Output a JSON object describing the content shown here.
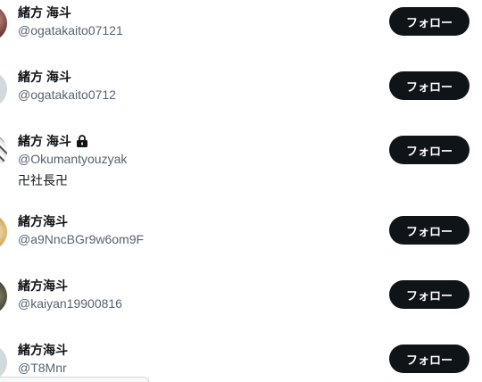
{
  "users": [
    {
      "name": "緒方 海斗",
      "handle": "@ogatakaito07121",
      "bio": "",
      "locked": false,
      "button": "フォロー",
      "avatar_icon": "user-avatar-photo"
    },
    {
      "name": "緒方 海斗",
      "handle": "@ogatakaito0712",
      "bio": "",
      "locked": false,
      "button": "フォロー",
      "avatar_icon": "default-avatar"
    },
    {
      "name": "緒方 海斗",
      "handle": "@Okumantyouzyak",
      "bio": "卍社長卍",
      "locked": true,
      "button": "フォロー",
      "avatar_icon": "user-avatar-photo"
    },
    {
      "name": "緒方海斗",
      "handle": "@a9NncBGr9w6om9F",
      "bio": "",
      "locked": false,
      "button": "フォロー",
      "avatar_icon": "user-avatar-photo"
    },
    {
      "name": "緒方海斗",
      "handle": "@kaiyan19900816",
      "bio": "",
      "locked": false,
      "button": "フォロー",
      "avatar_icon": "user-avatar-photo"
    },
    {
      "name": "緒方海斗",
      "handle": "@T8Mnr",
      "bio": "",
      "locked": false,
      "button": "フォロー",
      "avatar_icon": "default-avatar"
    }
  ],
  "colors": {
    "button_bg": "#0f1419",
    "button_text": "#ffffff",
    "handle": "#536471"
  }
}
